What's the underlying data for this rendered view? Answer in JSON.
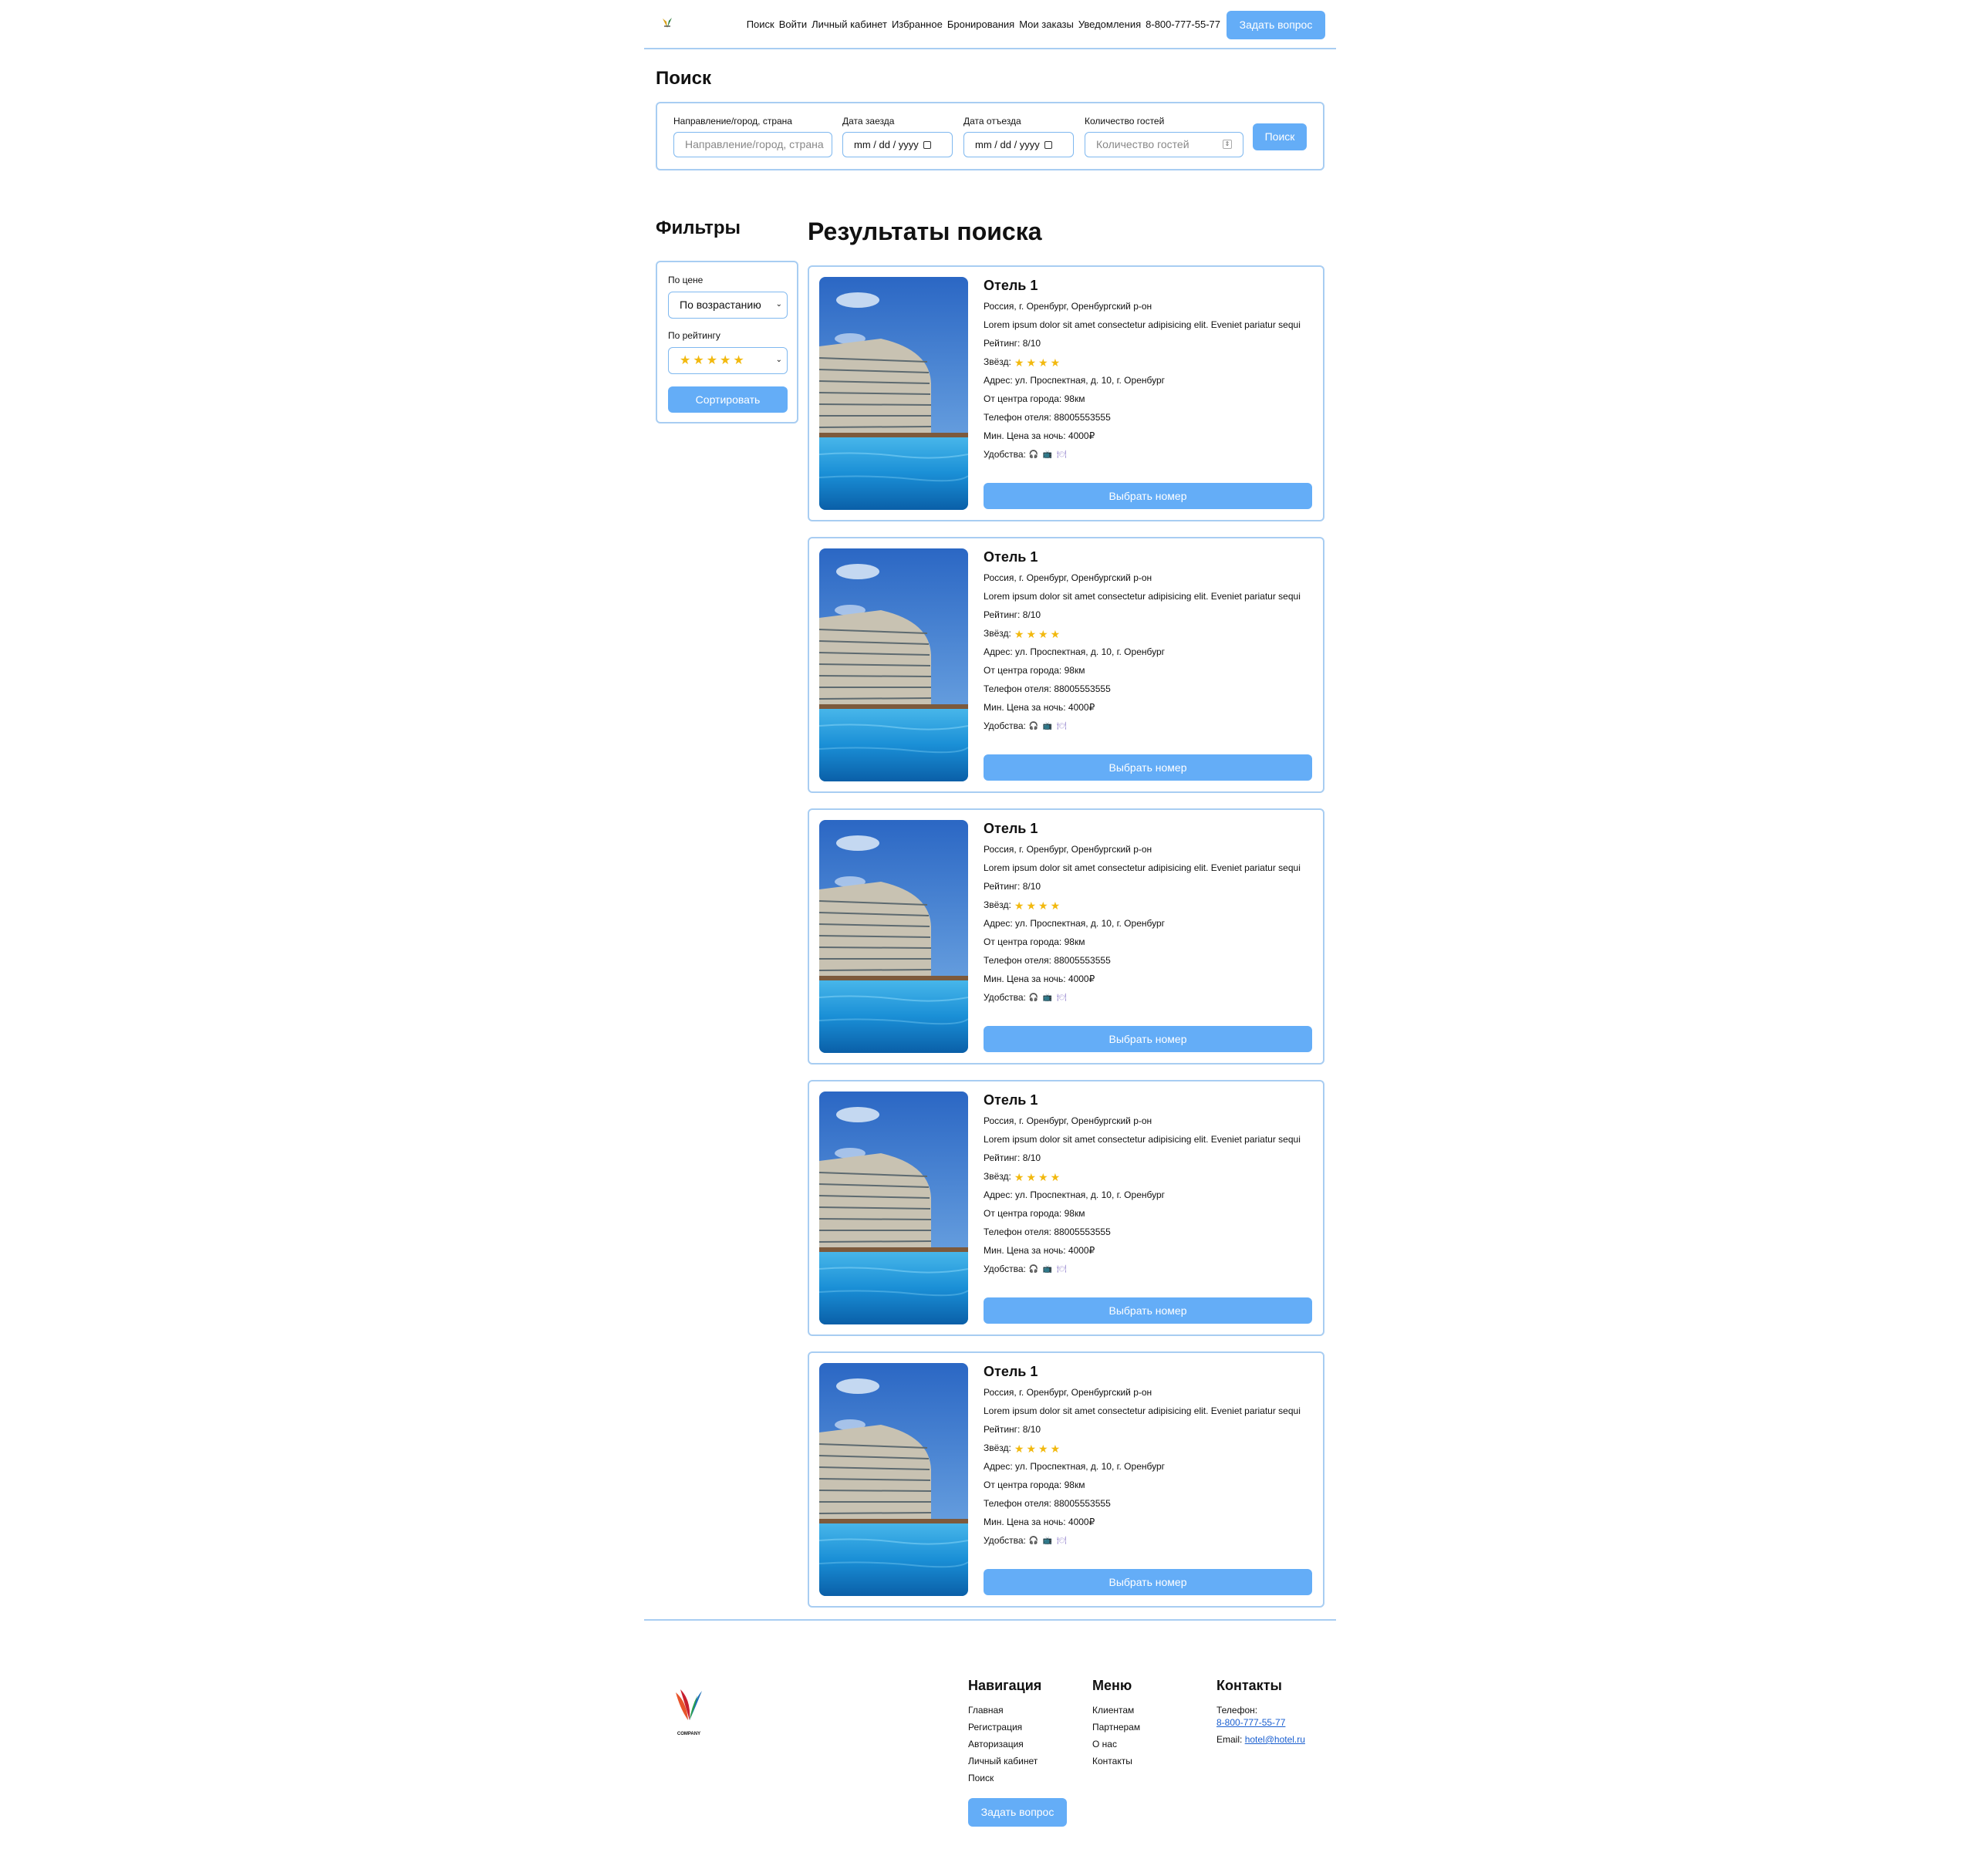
{
  "header": {
    "nav": [
      "Поиск",
      "Войти",
      "Личный кабинет",
      "Избранное",
      "Бронирования",
      "Мои заказы",
      "Уведомления",
      "8-800-777-55-77"
    ],
    "ask_button": "Задать вопрос"
  },
  "search": {
    "title": "Поиск",
    "destination_label": "Направление/город, страна",
    "destination_placeholder": "Направление/город, страна",
    "checkin_label": "Дата заезда",
    "checkin_value": "mm / dd / yyyy",
    "checkout_label": "Дата отъезда",
    "checkout_value": "mm / dd / yyyy",
    "guests_label": "Количество гостей",
    "guests_placeholder": "Количество гостей",
    "button": "Поиск"
  },
  "filters": {
    "title": "Фильтры",
    "price_label": "По цене",
    "price_value": "По возрастанию",
    "rating_label": "По рейтингу",
    "rating_value_stars": 5,
    "sort_button": "Сортировать"
  },
  "results": {
    "title": "Результаты поиска",
    "hotels": [
      {
        "name": "Отель 1",
        "location": "Россия, г. Оренбург, Оренбургский р-он",
        "description": "Lorem ipsum dolor sit amet consectetur adipisicing elit. Eveniet pariatur sequi",
        "rating": "Рейтинг: 8/10",
        "stars_label": "Звёзд:",
        "stars": 4,
        "address": "Адрес: ул. Проспектная, д. 10, г. Оренбург",
        "distance": "От центра города: 98км",
        "phone": "Телефон отеля: 88005553555",
        "price": "Мин. Цена за ночь: 4000₽",
        "amenities_label": "Удобства:",
        "button": "Выбрать номер"
      },
      {
        "name": "Отель 1",
        "location": "Россия, г. Оренбург, Оренбургский р-он",
        "description": "Lorem ipsum dolor sit amet consectetur adipisicing elit. Eveniet pariatur sequi",
        "rating": "Рейтинг: 8/10",
        "stars_label": "Звёзд:",
        "stars": 4,
        "address": "Адрес: ул. Проспектная, д. 10, г. Оренбург",
        "distance": "От центра города: 98км",
        "phone": "Телефон отеля: 88005553555",
        "price": "Мин. Цена за ночь: 4000₽",
        "amenities_label": "Удобства:",
        "button": "Выбрать номер"
      },
      {
        "name": "Отель 1",
        "location": "Россия, г. Оренбург, Оренбургский р-он",
        "description": "Lorem ipsum dolor sit amet consectetur adipisicing elit. Eveniet pariatur sequi",
        "rating": "Рейтинг: 8/10",
        "stars_label": "Звёзд:",
        "stars": 4,
        "address": "Адрес: ул. Проспектная, д. 10, г. Оренбург",
        "distance": "От центра города: 98км",
        "phone": "Телефон отеля: 88005553555",
        "price": "Мин. Цена за ночь: 4000₽",
        "amenities_label": "Удобства:",
        "button": "Выбрать номер"
      },
      {
        "name": "Отель 1",
        "location": "Россия, г. Оренбург, Оренбургский р-он",
        "description": "Lorem ipsum dolor sit amet consectetur adipisicing elit. Eveniet pariatur sequi",
        "rating": "Рейтинг: 8/10",
        "stars_label": "Звёзд:",
        "stars": 4,
        "address": "Адрес: ул. Проспектная, д. 10, г. Оренбург",
        "distance": "От центра города: 98км",
        "phone": "Телефон отеля: 88005553555",
        "price": "Мин. Цена за ночь: 4000₽",
        "amenities_label": "Удобства:",
        "button": "Выбрать номер"
      },
      {
        "name": "Отель 1",
        "location": "Россия, г. Оренбург, Оренбургский р-он",
        "description": "Lorem ipsum dolor sit amet consectetur adipisicing elit. Eveniet pariatur sequi",
        "rating": "Рейтинг: 8/10",
        "stars_label": "Звёзд:",
        "stars": 4,
        "address": "Адрес: ул. Проспектная, д. 10, г. Оренбург",
        "distance": "От центра города: 98км",
        "phone": "Телефон отеля: 88005553555",
        "price": "Мин. Цена за ночь: 4000₽",
        "amenities_label": "Удобства:",
        "button": "Выбрать номер"
      }
    ],
    "amenity_icons": [
      "headphones-icon",
      "tv-icon",
      "restaurant-icon"
    ]
  },
  "footer": {
    "logo_text": "COMPANY",
    "navigation": {
      "title": "Навигация",
      "items": [
        "Главная",
        "Регистрация",
        "Авторизация",
        "Личный кабинет",
        "Поиск"
      ]
    },
    "menu": {
      "title": "Меню",
      "items": [
        "Клиентам",
        "Партнерам",
        "О нас",
        "Контакты"
      ]
    },
    "contacts": {
      "title": "Контакты",
      "phone_label": "Телефон:",
      "phone": "8-800-777-55-77",
      "email_label": "Email:",
      "email": "hotel@hotel.ru"
    },
    "ask_button": "Задать вопрос"
  },
  "colors": {
    "accent": "#64adf7",
    "border": "#a8cdf2",
    "star": "#f2b90f"
  }
}
